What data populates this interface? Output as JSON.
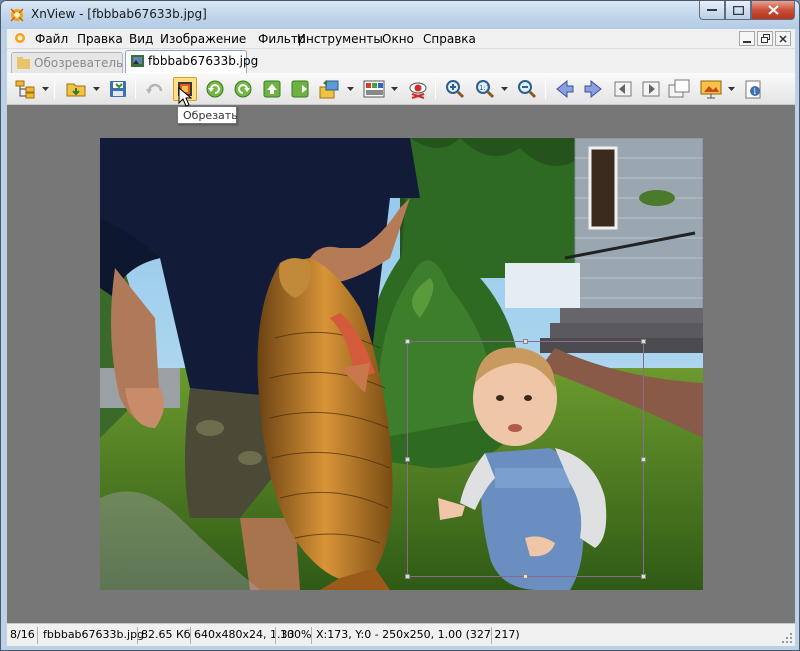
{
  "window": {
    "title": "XnView - [fbbbab67633b.jpg]"
  },
  "menu": {
    "items": [
      "Файл",
      "Правка",
      "Вид",
      "Изображение",
      "Фильтр",
      "Инструменты",
      "Окно",
      "Справка"
    ]
  },
  "tabs": [
    {
      "label": "Обозреватель",
      "active": false
    },
    {
      "label": "fbbbab67633b.jpg",
      "active": true
    }
  ],
  "toolbar": {
    "buttons": [
      "browser-icon",
      "open-folder-icon",
      "save-icon",
      "undo-icon",
      "crop-icon",
      "rotate-left-icon",
      "rotate-right-icon",
      "move-up-icon",
      "export-icon",
      "convert-icon",
      "adjust-colors-icon",
      "red-eye-icon",
      "zoom-in-icon",
      "zoom-fit-icon",
      "zoom-out-icon",
      "previous-icon",
      "next-icon",
      "first-page-icon",
      "last-page-icon",
      "fullscreen-icon",
      "slideshow-icon",
      "properties-icon"
    ],
    "tooltip": "Обрезать"
  },
  "status": {
    "index": "8/16",
    "filename": "fbbbab67633b.jpg",
    "filesize": "82.65 Кб",
    "dimensions": "640x480x24, 1.33",
    "zoom": "100%",
    "selection": "X:173, Y:0 - 250x250, 1.00 (327 217)"
  },
  "colors": {
    "titlebar": "#c2d6ec",
    "accent": "#ffe08a",
    "viewer_bg": "#777777"
  }
}
